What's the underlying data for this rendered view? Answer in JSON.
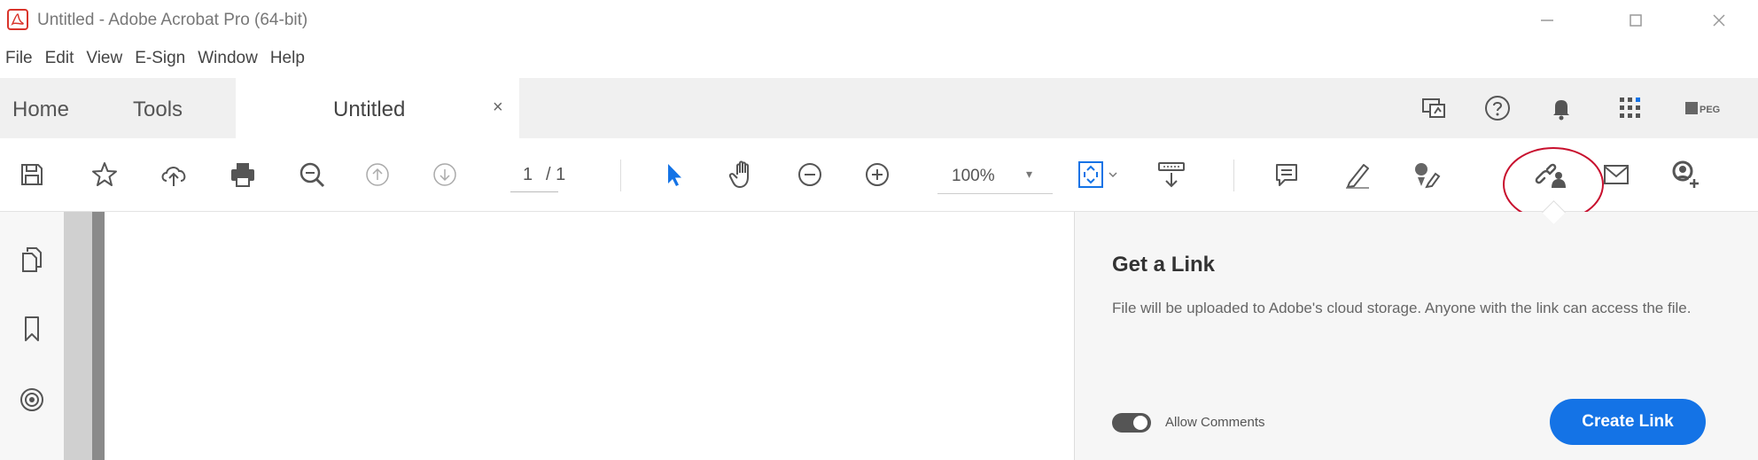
{
  "window": {
    "title": "Untitled - Adobe Acrobat Pro (64-bit)",
    "buttons": [
      "minimize-icon",
      "maximize-icon",
      "close-icon"
    ]
  },
  "menu": {
    "items": [
      "File",
      "Edit",
      "View",
      "E-Sign",
      "Window",
      "Help"
    ]
  },
  "tabs": {
    "home": "Home",
    "tools": "Tools",
    "document": "Untitled",
    "close": "×"
  },
  "toolbar": {
    "page_current": "1",
    "page_total": "/ 1",
    "zoom": "100%",
    "zoom_caret": "▾"
  },
  "panel": {
    "title": "Get a Link",
    "description": "File will be uploaded to Adobe's cloud storage. Anyone with the link can access the file.",
    "toggle_label": "Allow Comments",
    "toggle_on": true,
    "button_label": "Create Link"
  },
  "profile": {
    "badge_text": "PEG"
  },
  "colors": {
    "accent": "#1473e6",
    "highlight": "#c8102e",
    "pointer_tool": "#1473e6"
  }
}
